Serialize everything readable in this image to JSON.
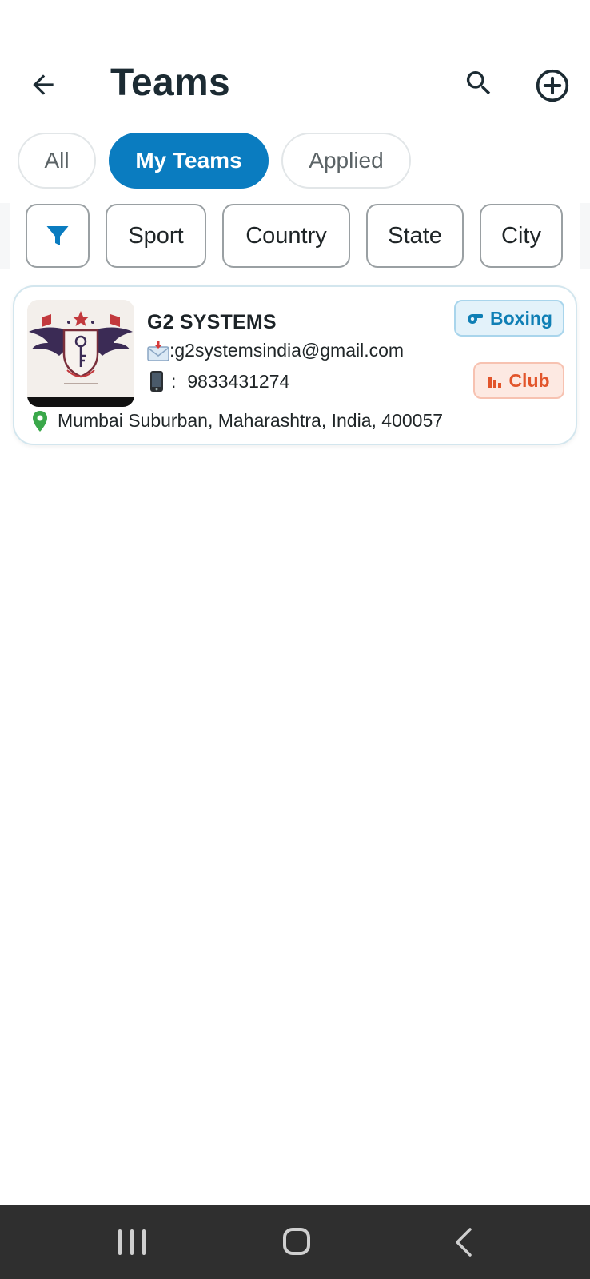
{
  "header": {
    "title": "Teams",
    "back_icon": "arrow-left-icon",
    "search_icon": "search-icon",
    "add_icon": "plus-circle-icon"
  },
  "tabs": [
    {
      "label": "All",
      "active": false
    },
    {
      "label": "My Teams",
      "active": true
    },
    {
      "label": "Applied",
      "active": false
    }
  ],
  "filters": {
    "funnel_icon": "filter-icon",
    "chips": [
      "Sport",
      "Country",
      "State",
      "City"
    ]
  },
  "teams": [
    {
      "name": "G2 SYSTEMS",
      "email": ":g2systemsindia@gmail.com",
      "phone": "9833431274",
      "phone_sep": ":",
      "location": "Mumbai Suburban, Maharashtra, India, 400057",
      "sport": "Boxing",
      "type": "Club"
    }
  ],
  "colors": {
    "accent": "#0a7cc0",
    "sport_badge": "#0f7fb5",
    "type_badge": "#e2552b",
    "location_pin": "#3aa84a",
    "navbar": "#2f2f2f"
  }
}
